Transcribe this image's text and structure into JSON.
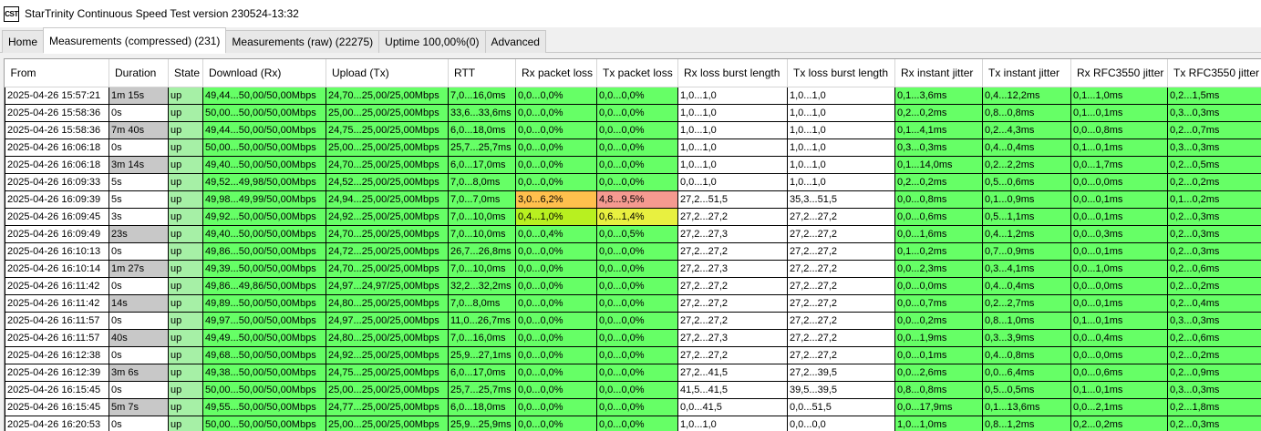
{
  "window": {
    "icon_label": "CST",
    "title": "StarTrinity Continuous Speed Test version 230524-13:32"
  },
  "tabs": [
    {
      "label": "Home",
      "active": false
    },
    {
      "label": "Measurements (compressed)  (231)",
      "active": true
    },
    {
      "label": "Measurements (raw)  (22275)",
      "active": false
    },
    {
      "label": "Uptime  100,00%(0)",
      "active": false
    },
    {
      "label": "Advanced",
      "active": false
    }
  ],
  "colors": {
    "green": "#66ff66",
    "lightgreen": "#a6f0a6",
    "white": "#ffffff",
    "gray": "#c8c8c8",
    "orange": "#ffc04d",
    "salmon": "#f59a90",
    "lime": "#b8f020",
    "yellow": "#e8f040"
  },
  "columns": [
    "From",
    "Duration",
    "State",
    "Download (Rx)",
    "Upload (Tx)",
    "RTT",
    "Rx packet loss",
    "Tx packet loss",
    "Rx loss burst length",
    "Tx loss burst length",
    "Rx instant jitter",
    "Tx instant jitter",
    "Rx RFC3550 jitter",
    "Tx RFC3550 jitter"
  ],
  "rows": [
    {
      "cells": [
        "2025-04-26 15:57:21",
        "1m 15s",
        "up",
        "49,44...50,00/50,00Mbps",
        "24,70...25,00/25,00Mbps",
        "7,0...16,0ms",
        "0,0...0,0%",
        "0,0...0,0%",
        "1,0...1,0",
        "1,0...1,0",
        "0,1...3,6ms",
        "0,4...12,2ms",
        "0,1...1,0ms",
        "0,2...1,5ms"
      ],
      "colors": [
        "white",
        "gray",
        "lightgreen",
        "green",
        "green",
        "green",
        "green",
        "green",
        "white",
        "white",
        "green",
        "green",
        "green",
        "green"
      ]
    },
    {
      "cells": [
        "2025-04-26 15:58:36",
        "0s",
        "up",
        "50,00...50,00/50,00Mbps",
        "25,00...25,00/25,00Mbps",
        "33,6...33,6ms",
        "0,0...0,0%",
        "0,0...0,0%",
        "1,0...1,0",
        "1,0...1,0",
        "0,2...0,2ms",
        "0,8...0,8ms",
        "0,1...0,1ms",
        "0,3...0,3ms"
      ],
      "colors": [
        "white",
        "white",
        "lightgreen",
        "green",
        "green",
        "green",
        "green",
        "green",
        "white",
        "white",
        "green",
        "green",
        "green",
        "green"
      ]
    },
    {
      "cells": [
        "2025-04-26 15:58:36",
        "7m 40s",
        "up",
        "49,44...50,00/50,00Mbps",
        "24,75...25,00/25,00Mbps",
        "6,0...18,0ms",
        "0,0...0,0%",
        "0,0...0,0%",
        "1,0...1,0",
        "1,0...1,0",
        "0,1...4,1ms",
        "0,2...4,3ms",
        "0,0...0,8ms",
        "0,2...0,7ms"
      ],
      "colors": [
        "white",
        "gray",
        "lightgreen",
        "green",
        "green",
        "green",
        "green",
        "green",
        "white",
        "white",
        "green",
        "green",
        "green",
        "green"
      ]
    },
    {
      "cells": [
        "2025-04-26 16:06:18",
        "0s",
        "up",
        "50,00...50,00/50,00Mbps",
        "25,00...25,00/25,00Mbps",
        "25,7...25,7ms",
        "0,0...0,0%",
        "0,0...0,0%",
        "1,0...1,0",
        "1,0...1,0",
        "0,3...0,3ms",
        "0,4...0,4ms",
        "0,1...0,1ms",
        "0,3...0,3ms"
      ],
      "colors": [
        "white",
        "white",
        "lightgreen",
        "green",
        "green",
        "green",
        "green",
        "green",
        "white",
        "white",
        "green",
        "green",
        "green",
        "green"
      ]
    },
    {
      "cells": [
        "2025-04-26 16:06:18",
        "3m 14s",
        "up",
        "49,40...50,00/50,00Mbps",
        "24,70...25,00/25,00Mbps",
        "6,0...17,0ms",
        "0,0...0,0%",
        "0,0...0,0%",
        "1,0...1,0",
        "1,0...1,0",
        "0,1...14,0ms",
        "0,2...2,2ms",
        "0,0...1,7ms",
        "0,2...0,5ms"
      ],
      "colors": [
        "white",
        "gray",
        "lightgreen",
        "green",
        "green",
        "green",
        "green",
        "green",
        "white",
        "white",
        "green",
        "green",
        "green",
        "green"
      ]
    },
    {
      "cells": [
        "2025-04-26 16:09:33",
        "5s",
        "up",
        "49,52...49,98/50,00Mbps",
        "24,52...25,00/25,00Mbps",
        "7,0...8,0ms",
        "0,0...0,0%",
        "0,0...0,0%",
        "0,0...1,0",
        "1,0...1,0",
        "0,2...0,2ms",
        "0,5...0,6ms",
        "0,0...0,0ms",
        "0,2...0,2ms"
      ],
      "colors": [
        "white",
        "white",
        "lightgreen",
        "green",
        "green",
        "green",
        "green",
        "green",
        "white",
        "white",
        "green",
        "green",
        "green",
        "green"
      ]
    },
    {
      "cells": [
        "2025-04-26 16:09:39",
        "5s",
        "up",
        "49,98...49,99/50,00Mbps",
        "24,94...25,00/25,00Mbps",
        "7,0...7,0ms",
        "3,0...6,2%",
        "4,8...9,5%",
        "27,2...51,5",
        "35,3...51,5",
        "0,0...0,8ms",
        "0,1...0,9ms",
        "0,0...0,1ms",
        "0,1...0,2ms"
      ],
      "colors": [
        "white",
        "white",
        "lightgreen",
        "green",
        "green",
        "green",
        "orange",
        "salmon",
        "white",
        "white",
        "green",
        "green",
        "green",
        "green"
      ]
    },
    {
      "cells": [
        "2025-04-26 16:09:45",
        "3s",
        "up",
        "49,92...50,00/50,00Mbps",
        "24,92...25,00/25,00Mbps",
        "7,0...10,0ms",
        "0,4...1,0%",
        "0,6...1,4%",
        "27,2...27,2",
        "27,2...27,2",
        "0,0...0,6ms",
        "0,5...1,1ms",
        "0,0...0,1ms",
        "0,2...0,3ms"
      ],
      "colors": [
        "white",
        "white",
        "lightgreen",
        "green",
        "green",
        "green",
        "lime",
        "yellow",
        "white",
        "white",
        "green",
        "green",
        "green",
        "green"
      ]
    },
    {
      "cells": [
        "2025-04-26 16:09:49",
        "23s",
        "up",
        "49,40...50,00/50,00Mbps",
        "24,70...25,00/25,00Mbps",
        "7,0...10,0ms",
        "0,0...0,4%",
        "0,0...0,5%",
        "27,2...27,3",
        "27,2...27,2",
        "0,0...1,6ms",
        "0,4...1,2ms",
        "0,0...0,3ms",
        "0,2...0,3ms"
      ],
      "colors": [
        "white",
        "gray",
        "lightgreen",
        "green",
        "green",
        "green",
        "green",
        "green",
        "white",
        "white",
        "green",
        "green",
        "green",
        "green"
      ]
    },
    {
      "cells": [
        "2025-04-26 16:10:13",
        "0s",
        "up",
        "49,86...50,00/50,00Mbps",
        "24,72...25,00/25,00Mbps",
        "26,7...26,8ms",
        "0,0...0,0%",
        "0,0...0,0%",
        "27,2...27,2",
        "27,2...27,2",
        "0,1...0,2ms",
        "0,7...0,9ms",
        "0,0...0,1ms",
        "0,2...0,3ms"
      ],
      "colors": [
        "white",
        "white",
        "lightgreen",
        "green",
        "green",
        "green",
        "green",
        "green",
        "white",
        "white",
        "green",
        "green",
        "green",
        "green"
      ]
    },
    {
      "cells": [
        "2025-04-26 16:10:14",
        "1m 27s",
        "up",
        "49,39...50,00/50,00Mbps",
        "24,70...25,00/25,00Mbps",
        "7,0...10,0ms",
        "0,0...0,0%",
        "0,0...0,0%",
        "27,2...27,3",
        "27,2...27,2",
        "0,0...2,3ms",
        "0,3...4,1ms",
        "0,0...1,0ms",
        "0,2...0,6ms"
      ],
      "colors": [
        "white",
        "gray",
        "lightgreen",
        "green",
        "green",
        "green",
        "green",
        "green",
        "white",
        "white",
        "green",
        "green",
        "green",
        "green"
      ]
    },
    {
      "cells": [
        "2025-04-26 16:11:42",
        "0s",
        "up",
        "49,86...49,86/50,00Mbps",
        "24,97...24,97/25,00Mbps",
        "32,2...32,2ms",
        "0,0...0,0%",
        "0,0...0,0%",
        "27,2...27,2",
        "27,2...27,2",
        "0,0...0,0ms",
        "0,4...0,4ms",
        "0,0...0,0ms",
        "0,2...0,2ms"
      ],
      "colors": [
        "white",
        "white",
        "lightgreen",
        "green",
        "green",
        "green",
        "green",
        "green",
        "white",
        "white",
        "green",
        "green",
        "green",
        "green"
      ]
    },
    {
      "cells": [
        "2025-04-26 16:11:42",
        "14s",
        "up",
        "49,89...50,00/50,00Mbps",
        "24,80...25,00/25,00Mbps",
        "7,0...8,0ms",
        "0,0...0,0%",
        "0,0...0,0%",
        "27,2...27,2",
        "27,2...27,2",
        "0,0...0,7ms",
        "0,2...2,7ms",
        "0,0...0,1ms",
        "0,2...0,4ms"
      ],
      "colors": [
        "white",
        "gray",
        "lightgreen",
        "green",
        "green",
        "green",
        "green",
        "green",
        "white",
        "white",
        "green",
        "green",
        "green",
        "green"
      ]
    },
    {
      "cells": [
        "2025-04-26 16:11:57",
        "0s",
        "up",
        "49,97...50,00/50,00Mbps",
        "24,97...25,00/25,00Mbps",
        "11,0...26,7ms",
        "0,0...0,0%",
        "0,0...0,0%",
        "27,2...27,2",
        "27,2...27,2",
        "0,0...0,2ms",
        "0,8...1,0ms",
        "0,1...0,1ms",
        "0,3...0,3ms"
      ],
      "colors": [
        "white",
        "white",
        "lightgreen",
        "green",
        "green",
        "green",
        "green",
        "green",
        "white",
        "white",
        "green",
        "green",
        "green",
        "green"
      ]
    },
    {
      "cells": [
        "2025-04-26 16:11:57",
        "40s",
        "up",
        "49,49...50,00/50,00Mbps",
        "24,80...25,00/25,00Mbps",
        "7,0...16,0ms",
        "0,0...0,0%",
        "0,0...0,0%",
        "27,2...27,3",
        "27,2...27,2",
        "0,0...1,9ms",
        "0,3...3,9ms",
        "0,0...0,4ms",
        "0,2...0,6ms"
      ],
      "colors": [
        "white",
        "gray",
        "lightgreen",
        "green",
        "green",
        "green",
        "green",
        "green",
        "white",
        "white",
        "green",
        "green",
        "green",
        "green"
      ]
    },
    {
      "cells": [
        "2025-04-26 16:12:38",
        "0s",
        "up",
        "49,68...50,00/50,00Mbps",
        "24,92...25,00/25,00Mbps",
        "25,9...27,1ms",
        "0,0...0,0%",
        "0,0...0,0%",
        "27,2...27,2",
        "27,2...27,2",
        "0,0...0,1ms",
        "0,4...0,8ms",
        "0,0...0,0ms",
        "0,2...0,2ms"
      ],
      "colors": [
        "white",
        "white",
        "lightgreen",
        "green",
        "green",
        "green",
        "green",
        "green",
        "white",
        "white",
        "green",
        "green",
        "green",
        "green"
      ]
    },
    {
      "cells": [
        "2025-04-26 16:12:39",
        "3m 6s",
        "up",
        "49,38...50,00/50,00Mbps",
        "24,75...25,00/25,00Mbps",
        "6,0...17,0ms",
        "0,0...0,0%",
        "0,0...0,0%",
        "27,2...41,5",
        "27,2...39,5",
        "0,0...2,6ms",
        "0,0...6,4ms",
        "0,0...0,6ms",
        "0,2...0,9ms"
      ],
      "colors": [
        "white",
        "gray",
        "lightgreen",
        "green",
        "green",
        "green",
        "green",
        "green",
        "white",
        "white",
        "green",
        "green",
        "green",
        "green"
      ]
    },
    {
      "cells": [
        "2025-04-26 16:15:45",
        "0s",
        "up",
        "50,00...50,00/50,00Mbps",
        "25,00...25,00/25,00Mbps",
        "25,7...25,7ms",
        "0,0...0,0%",
        "0,0...0,0%",
        "41,5...41,5",
        "39,5...39,5",
        "0,8...0,8ms",
        "0,5...0,5ms",
        "0,1...0,1ms",
        "0,3...0,3ms"
      ],
      "colors": [
        "white",
        "white",
        "lightgreen",
        "green",
        "green",
        "green",
        "green",
        "green",
        "white",
        "white",
        "green",
        "green",
        "green",
        "green"
      ]
    },
    {
      "cells": [
        "2025-04-26 16:15:45",
        "5m 7s",
        "up",
        "49,55...50,00/50,00Mbps",
        "24,77...25,00/25,00Mbps",
        "6,0...18,0ms",
        "0,0...0,0%",
        "0,0...0,0%",
        "0,0...41,5",
        "0,0...51,5",
        "0,0...17,9ms",
        "0,1...13,6ms",
        "0,0...2,1ms",
        "0,2...1,8ms"
      ],
      "colors": [
        "white",
        "gray",
        "lightgreen",
        "green",
        "green",
        "green",
        "green",
        "green",
        "white",
        "white",
        "green",
        "green",
        "green",
        "green"
      ]
    },
    {
      "cells": [
        "2025-04-26 16:20:53",
        "0s",
        "up",
        "50,00...50,00/50,00Mbps",
        "25,00...25,00/25,00Mbps",
        "25,9...25,9ms",
        "0,0...0,0%",
        "0,0...0,0%",
        "1,0...1,0",
        "0,0...0,0",
        "1,0...1,0ms",
        "0,8...1,2ms",
        "0,2...0,2ms",
        "0,2...0,3ms"
      ],
      "colors": [
        "white",
        "white",
        "lightgreen",
        "green",
        "green",
        "green",
        "green",
        "green",
        "white",
        "white",
        "green",
        "green",
        "green",
        "green"
      ]
    }
  ]
}
